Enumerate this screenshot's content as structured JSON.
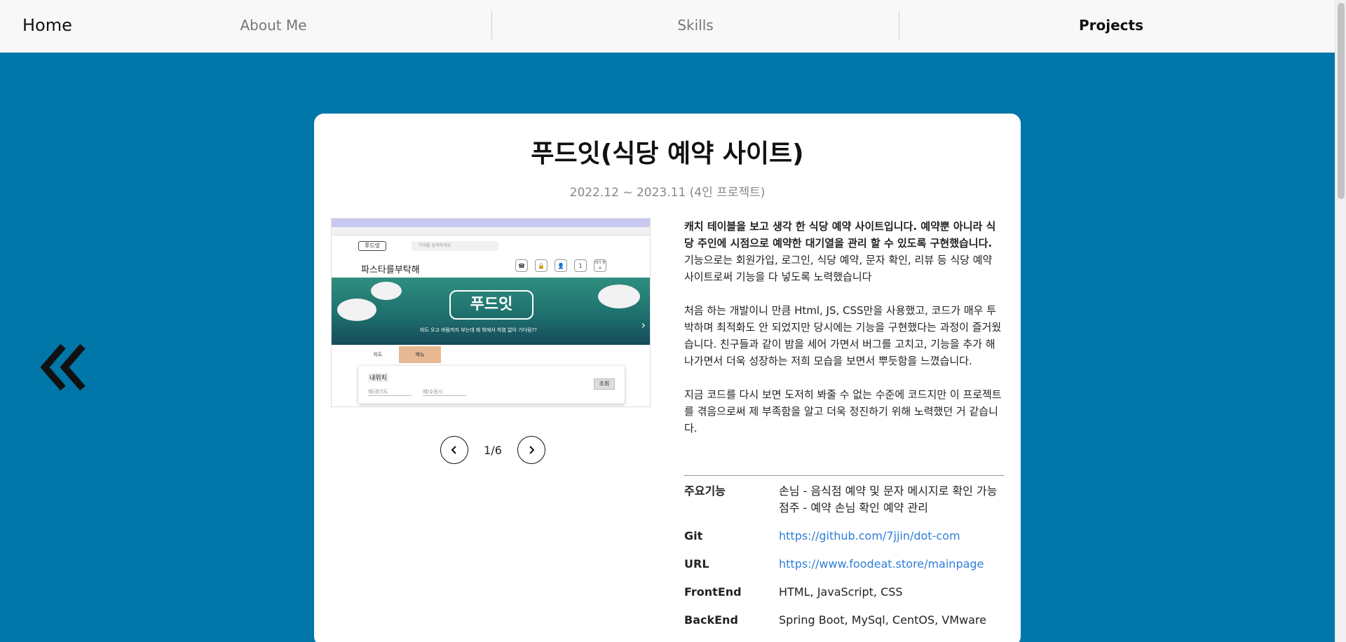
{
  "nav": {
    "home": "Home",
    "items": [
      {
        "label": "About Me"
      },
      {
        "label": "Skills"
      },
      {
        "label": "Projects"
      }
    ]
  },
  "project": {
    "title": "푸드잇(식당 예약 사이트)",
    "period": "2022.12 ~ 2023.11 (4인 프로젝트)",
    "desc": {
      "intro_bold": "캐치 테이블을 보고 생각 한 식당 예약 사이트입니다. 예약뿐 아니라 식당 주인에 시점으로 예약한 대기열을 관리 할 수 있도록 구현했습니다.",
      "intro": "기능으로는 회원가입, 로그인, 식당 예약, 문자 확인, 리뷰 등 식당 예약 사이트로써 기능을 다 넣도록 노력했습니다",
      "p2": "처음 하는 개발이니 만큼 Html, JS, CSS만을 사용했고, 코드가 매우 투박하며 최적화도 안 되었지만 당시에는 기능을 구현했다는 과정이 즐거웠습니다. 친구들과 같이 밤을 세어 가면서 버그를 고치고, 기능을 추가 해 나가면서 더욱 성장하는 저희 모습을 보면서 뿌듯함을 느꼈습니다.",
      "p3": "지금 코드를 다시 보면 도저히 봐줄 수 없는 수준에 코드지만 이 프로젝트를 겪음으로써 제 부족함을 알고 더욱 정진하기 위해 노력했던 거 같습니다."
    },
    "info": {
      "features_label": "주요기능",
      "features": [
        "손님 - 음식점 예약 및 문자 메시지로 확인 가능",
        "점주 - 예약 손님 확인 예약 관리"
      ],
      "git_label": "Git",
      "git": "https://github.com/7jjin/dot-com",
      "url_label": "URL",
      "url": "https://www.foodeat.store/mainpage",
      "frontend_label": "FrontEnd",
      "frontend": "HTML, JavaScript, CSS",
      "backend_label": "BackEnd",
      "backend": "Spring Boot, MySql, CentOS, VMware"
    },
    "pager": {
      "current": 1,
      "total": 6,
      "text": "1/6"
    },
    "screenshot": {
      "logo": "푸드잇",
      "search_placeholder": "가게를 검색하세요",
      "restaurant": "파스타를부탁해",
      "icons_badge": "1",
      "icons_wait": "대기 취소",
      "brand": "푸드잇",
      "tagline": "비도 오고 바람까지 부는데 왜 밖에서 하염 없이 기다림??",
      "tab_location": "지도",
      "tab_menu": "메뉴",
      "box_label": "내위치",
      "field1": "예)경기도",
      "field2": "예)수원시",
      "go": "조회"
    }
  },
  "colors": {
    "background": "#0077a8",
    "nav_bg": "#f8f8f8",
    "link": "#2f7ed8"
  }
}
